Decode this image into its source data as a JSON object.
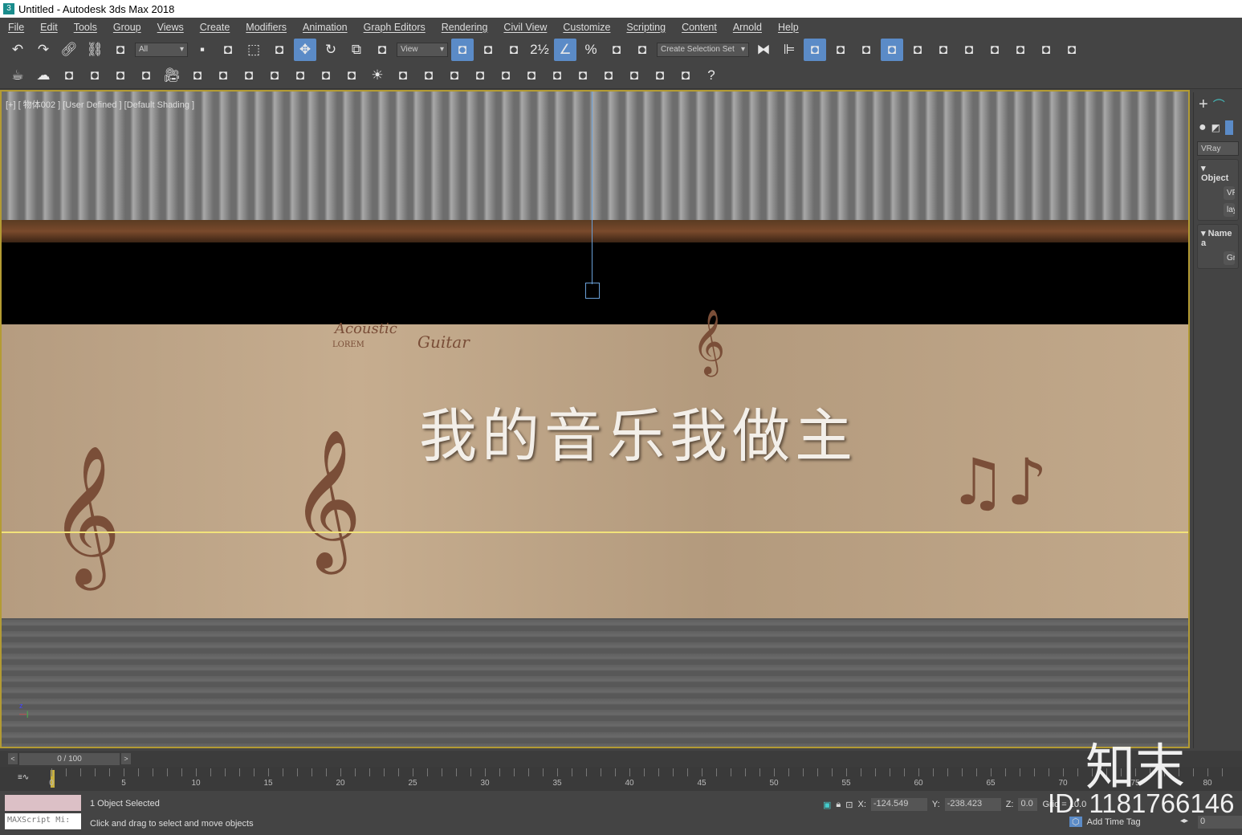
{
  "window": {
    "title": "Untitled - Autodesk 3ds Max 2018"
  },
  "menu": [
    "File",
    "Edit",
    "Tools",
    "Group",
    "Views",
    "Create",
    "Modifiers",
    "Animation",
    "Graph Editors",
    "Rendering",
    "Civil View",
    "Customize",
    "Scripting",
    "Content",
    "Arnold",
    "Help"
  ],
  "toolbar1": {
    "filter": "All",
    "ref_coord": "View",
    "selection_set": "Create Selection Set",
    "icons_a": [
      "undo-icon",
      "redo-icon",
      "link-icon",
      "unlink-icon",
      "bind-spacewarp-icon"
    ],
    "icons_b": [
      "select-object-icon",
      "select-by-name-icon",
      "rectangle-selection-icon",
      "window-crossing-icon",
      "move-icon",
      "rotate-icon",
      "scale-icon",
      "placement-icon"
    ],
    "icons_c": [
      "use-pivot-icon",
      "move-gizmo-icon",
      "keyboard-shortcut-icon",
      "snap-2-5-icon",
      "angle-snap-icon",
      "percent-snap-icon",
      "spinner-snap-icon",
      "edit-named-selection-icon"
    ],
    "icons_d": [
      "mirror-icon",
      "align-icon",
      "scene-explorer-icon",
      "layer-explorer-icon",
      "toggle-ribbon-icon",
      "curve-editor-icon",
      "dope-sheet-icon",
      "material-editor-icon",
      "render-setup-icon",
      "rendered-frame-icon",
      "render-icon",
      "render-iterative-icon",
      "render-gallery-icon"
    ]
  },
  "toolbar2": {
    "icons": [
      "teapot-icon",
      "cloud-icon",
      "frame-buffer-icon",
      "table-icon",
      "grid-icon",
      "light-lister-icon",
      "camera-icon",
      "sphere-half-icon",
      "render-elements-icon",
      "plane-light-icon",
      "dome-light-icon",
      "sphere-light-icon",
      "ies-light-icon",
      "spot-light-icon",
      "sun-icon",
      "ambient-light-icon",
      "fur-icon",
      "proxy-icon",
      "mesh-icon",
      "fluid-icon",
      "plant-icon",
      "hair-icon",
      "ball-icon",
      "material-sphere-icon",
      "lightmix-icon",
      "vfb-icon",
      "scene-converter-icon",
      "help-icon"
    ]
  },
  "viewport": {
    "label": "[+] [ 物体002 ] [User Defined ] [Default Shading ]",
    "wall_text": "我的音乐我做主",
    "deco_text_1": "Acoustic",
    "deco_text_2": "Guitar",
    "deco_text_3": "LOREM"
  },
  "command_panel": {
    "tabs": [
      "create-tab",
      "modify-tab"
    ],
    "renderer": "VRay",
    "rollout_1": "Object",
    "button_1": "VRa",
    "button_2": "layAm",
    "rollout_2": "Name a",
    "button_3": "Group"
  },
  "time_slider": {
    "value": "0 / 100",
    "prev": "<",
    "next": ">"
  },
  "track": {
    "labels": [
      "0",
      "5",
      "10",
      "15",
      "20",
      "25",
      "30",
      "35",
      "40",
      "45",
      "50",
      "55",
      "60",
      "65",
      "70",
      "75",
      "80"
    ]
  },
  "status": {
    "selected": "1 Object Selected",
    "prompt": "Click and drag to select and move objects",
    "maxscript": "MAXScript Mi:",
    "x_label": "X:",
    "x": "-124.549",
    "y_label": "Y:",
    "y": "-238.423",
    "z_label": "Z:",
    "z": "0.0",
    "grid": "Grid = 10.0",
    "add_time_tag": "Add Time Tag",
    "frame": "0"
  },
  "watermark": {
    "logo": "知末",
    "id": "ID: 1181766146"
  }
}
